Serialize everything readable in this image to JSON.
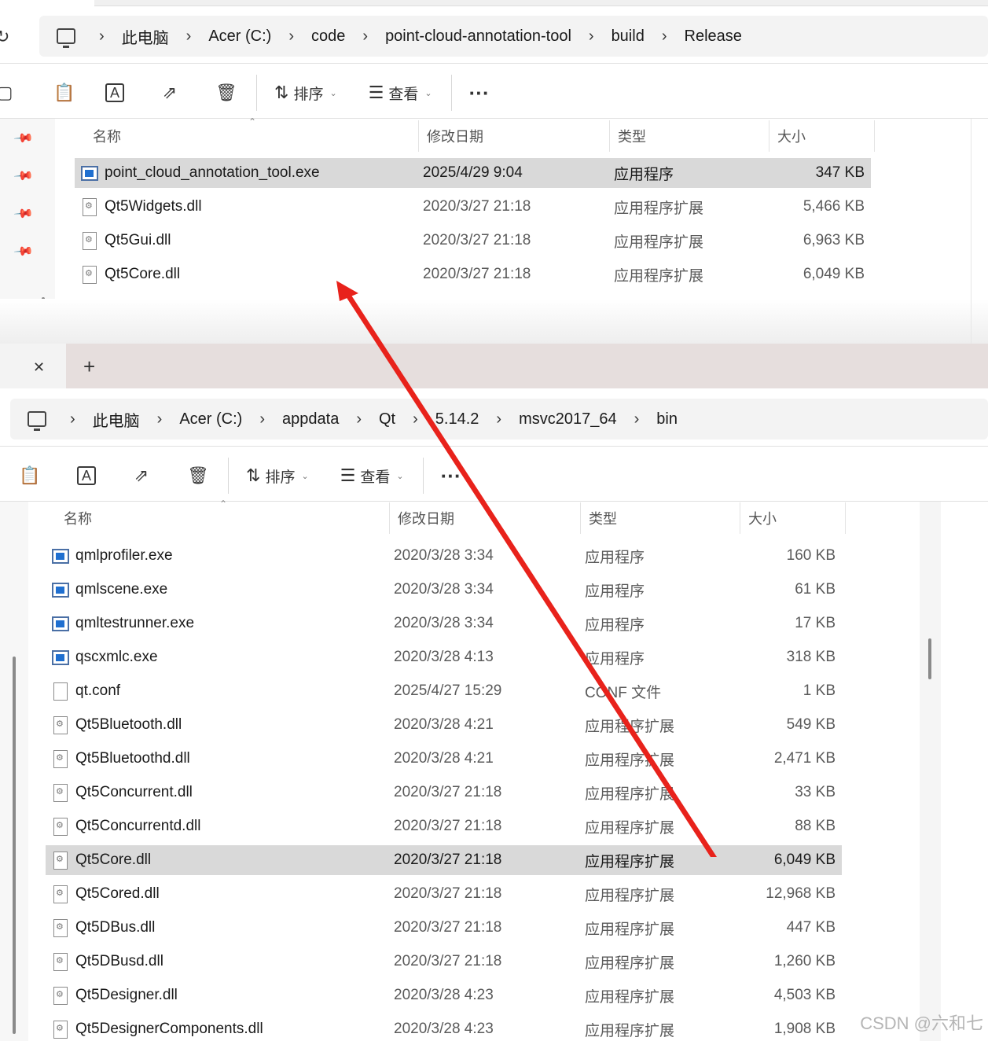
{
  "top": {
    "breadcrumb": [
      "此电脑",
      "Acer (C:)",
      "code",
      "point-cloud-annotation-tool",
      "build",
      "Release"
    ],
    "toolbar": {
      "sort_label": "排序",
      "view_label": "查看",
      "more_label": "···"
    },
    "columns": {
      "name": "名称",
      "date": "修改日期",
      "type": "类型",
      "size": "大小"
    },
    "files": [
      {
        "name": "point_cloud_annotation_tool.exe",
        "date": "2025/4/29 9:04",
        "type": "应用程序",
        "size": "347 KB",
        "icon": "exe",
        "selected": true
      },
      {
        "name": "Qt5Widgets.dll",
        "date": "2020/3/27 21:18",
        "type": "应用程序扩展",
        "size": "5,466 KB",
        "icon": "dll"
      },
      {
        "name": "Qt5Gui.dll",
        "date": "2020/3/27 21:18",
        "type": "应用程序扩展",
        "size": "6,963 KB",
        "icon": "dll"
      },
      {
        "name": "Qt5Core.dll",
        "date": "2020/3/27 21:18",
        "type": "应用程序扩展",
        "size": "6,049 KB",
        "icon": "dll"
      }
    ]
  },
  "bottom": {
    "tabs": {
      "close_label": "✕",
      "new_label": "+"
    },
    "breadcrumb": [
      "此电脑",
      "Acer (C:)",
      "appdata",
      "Qt",
      "5.14.2",
      "msvc2017_64",
      "bin"
    ],
    "toolbar": {
      "sort_label": "排序",
      "view_label": "查看",
      "more_label": "···"
    },
    "columns": {
      "name": "名称",
      "date": "修改日期",
      "type": "类型",
      "size": "大小"
    },
    "files": [
      {
        "name": "qmlprofiler.exe",
        "date": "2020/3/28 3:34",
        "type": "应用程序",
        "size": "160 KB",
        "icon": "exe"
      },
      {
        "name": "qmlscene.exe",
        "date": "2020/3/28 3:34",
        "type": "应用程序",
        "size": "61 KB",
        "icon": "exe"
      },
      {
        "name": "qmltestrunner.exe",
        "date": "2020/3/28 3:34",
        "type": "应用程序",
        "size": "17 KB",
        "icon": "exe"
      },
      {
        "name": "qscxmlc.exe",
        "date": "2020/3/28 4:13",
        "type": "应用程序",
        "size": "318 KB",
        "icon": "exe"
      },
      {
        "name": "qt.conf",
        "date": "2025/4/27 15:29",
        "type": "CONF 文件",
        "size": "1 KB",
        "icon": "file"
      },
      {
        "name": "Qt5Bluetooth.dll",
        "date": "2020/3/28 4:21",
        "type": "应用程序扩展",
        "size": "549 KB",
        "icon": "dll"
      },
      {
        "name": "Qt5Bluetoothd.dll",
        "date": "2020/3/28 4:21",
        "type": "应用程序扩展",
        "size": "2,471 KB",
        "icon": "dll"
      },
      {
        "name": "Qt5Concurrent.dll",
        "date": "2020/3/27 21:18",
        "type": "应用程序扩展",
        "size": "33 KB",
        "icon": "dll"
      },
      {
        "name": "Qt5Concurrentd.dll",
        "date": "2020/3/27 21:18",
        "type": "应用程序扩展",
        "size": "88 KB",
        "icon": "dll"
      },
      {
        "name": "Qt5Core.dll",
        "date": "2020/3/27 21:18",
        "type": "应用程序扩展",
        "size": "6,049 KB",
        "icon": "dll",
        "selected": true
      },
      {
        "name": "Qt5Cored.dll",
        "date": "2020/3/27 21:18",
        "type": "应用程序扩展",
        "size": "12,968 KB",
        "icon": "dll"
      },
      {
        "name": "Qt5DBus.dll",
        "date": "2020/3/27 21:18",
        "type": "应用程序扩展",
        "size": "447 KB",
        "icon": "dll"
      },
      {
        "name": "Qt5DBusd.dll",
        "date": "2020/3/27 21:18",
        "type": "应用程序扩展",
        "size": "1,260 KB",
        "icon": "dll"
      },
      {
        "name": "Qt5Designer.dll",
        "date": "2020/3/28 4:23",
        "type": "应用程序扩展",
        "size": "4,503 KB",
        "icon": "dll"
      },
      {
        "name": "Qt5DesignerComponents.dll",
        "date": "2020/3/28 4:23",
        "type": "应用程序扩展",
        "size": "1,908 KB",
        "icon": "dll"
      }
    ]
  },
  "annotation": {
    "arrow_color": "#e8221b"
  },
  "watermark": "CSDN @六和七"
}
